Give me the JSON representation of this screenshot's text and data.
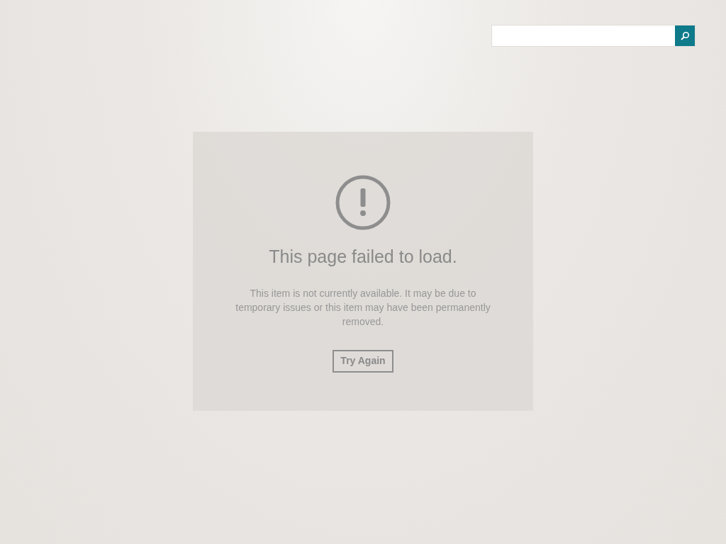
{
  "error": {
    "title": "This page failed to load.",
    "message": "This item is not currently available. It may be due to temporary issues or this item may have been permanently removed.",
    "button": "Try Again"
  }
}
